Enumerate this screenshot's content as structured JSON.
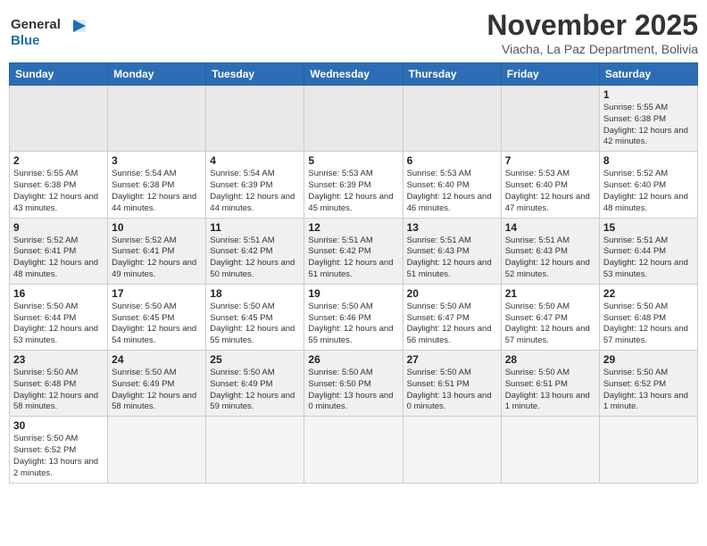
{
  "header": {
    "logo_general": "General",
    "logo_blue": "Blue",
    "month_title": "November 2025",
    "location": "Viacha, La Paz Department, Bolivia"
  },
  "days_of_week": [
    "Sunday",
    "Monday",
    "Tuesday",
    "Wednesday",
    "Thursday",
    "Friday",
    "Saturday"
  ],
  "weeks": [
    [
      {
        "day": "",
        "info": ""
      },
      {
        "day": "",
        "info": ""
      },
      {
        "day": "",
        "info": ""
      },
      {
        "day": "",
        "info": ""
      },
      {
        "day": "",
        "info": ""
      },
      {
        "day": "",
        "info": ""
      },
      {
        "day": "1",
        "info": "Sunrise: 5:55 AM\nSunset: 6:38 PM\nDaylight: 12 hours and 42 minutes."
      }
    ],
    [
      {
        "day": "2",
        "info": "Sunrise: 5:55 AM\nSunset: 6:38 PM\nDaylight: 12 hours and 43 minutes."
      },
      {
        "day": "3",
        "info": "Sunrise: 5:54 AM\nSunset: 6:38 PM\nDaylight: 12 hours and 44 minutes."
      },
      {
        "day": "4",
        "info": "Sunrise: 5:54 AM\nSunset: 6:39 PM\nDaylight: 12 hours and 44 minutes."
      },
      {
        "day": "5",
        "info": "Sunrise: 5:53 AM\nSunset: 6:39 PM\nDaylight: 12 hours and 45 minutes."
      },
      {
        "day": "6",
        "info": "Sunrise: 5:53 AM\nSunset: 6:40 PM\nDaylight: 12 hours and 46 minutes."
      },
      {
        "day": "7",
        "info": "Sunrise: 5:53 AM\nSunset: 6:40 PM\nDaylight: 12 hours and 47 minutes."
      },
      {
        "day": "8",
        "info": "Sunrise: 5:52 AM\nSunset: 6:40 PM\nDaylight: 12 hours and 48 minutes."
      }
    ],
    [
      {
        "day": "9",
        "info": "Sunrise: 5:52 AM\nSunset: 6:41 PM\nDaylight: 12 hours and 48 minutes."
      },
      {
        "day": "10",
        "info": "Sunrise: 5:52 AM\nSunset: 6:41 PM\nDaylight: 12 hours and 49 minutes."
      },
      {
        "day": "11",
        "info": "Sunrise: 5:51 AM\nSunset: 6:42 PM\nDaylight: 12 hours and 50 minutes."
      },
      {
        "day": "12",
        "info": "Sunrise: 5:51 AM\nSunset: 6:42 PM\nDaylight: 12 hours and 51 minutes."
      },
      {
        "day": "13",
        "info": "Sunrise: 5:51 AM\nSunset: 6:43 PM\nDaylight: 12 hours and 51 minutes."
      },
      {
        "day": "14",
        "info": "Sunrise: 5:51 AM\nSunset: 6:43 PM\nDaylight: 12 hours and 52 minutes."
      },
      {
        "day": "15",
        "info": "Sunrise: 5:51 AM\nSunset: 6:44 PM\nDaylight: 12 hours and 53 minutes."
      }
    ],
    [
      {
        "day": "16",
        "info": "Sunrise: 5:50 AM\nSunset: 6:44 PM\nDaylight: 12 hours and 53 minutes."
      },
      {
        "day": "17",
        "info": "Sunrise: 5:50 AM\nSunset: 6:45 PM\nDaylight: 12 hours and 54 minutes."
      },
      {
        "day": "18",
        "info": "Sunrise: 5:50 AM\nSunset: 6:45 PM\nDaylight: 12 hours and 55 minutes."
      },
      {
        "day": "19",
        "info": "Sunrise: 5:50 AM\nSunset: 6:46 PM\nDaylight: 12 hours and 55 minutes."
      },
      {
        "day": "20",
        "info": "Sunrise: 5:50 AM\nSunset: 6:47 PM\nDaylight: 12 hours and 56 minutes."
      },
      {
        "day": "21",
        "info": "Sunrise: 5:50 AM\nSunset: 6:47 PM\nDaylight: 12 hours and 57 minutes."
      },
      {
        "day": "22",
        "info": "Sunrise: 5:50 AM\nSunset: 6:48 PM\nDaylight: 12 hours and 57 minutes."
      }
    ],
    [
      {
        "day": "23",
        "info": "Sunrise: 5:50 AM\nSunset: 6:48 PM\nDaylight: 12 hours and 58 minutes."
      },
      {
        "day": "24",
        "info": "Sunrise: 5:50 AM\nSunset: 6:49 PM\nDaylight: 12 hours and 58 minutes."
      },
      {
        "day": "25",
        "info": "Sunrise: 5:50 AM\nSunset: 6:49 PM\nDaylight: 12 hours and 59 minutes."
      },
      {
        "day": "26",
        "info": "Sunrise: 5:50 AM\nSunset: 6:50 PM\nDaylight: 13 hours and 0 minutes."
      },
      {
        "day": "27",
        "info": "Sunrise: 5:50 AM\nSunset: 6:51 PM\nDaylight: 13 hours and 0 minutes."
      },
      {
        "day": "28",
        "info": "Sunrise: 5:50 AM\nSunset: 6:51 PM\nDaylight: 13 hours and 1 minute."
      },
      {
        "day": "29",
        "info": "Sunrise: 5:50 AM\nSunset: 6:52 PM\nDaylight: 13 hours and 1 minute."
      }
    ],
    [
      {
        "day": "30",
        "info": "Sunrise: 5:50 AM\nSunset: 6:52 PM\nDaylight: 13 hours and 2 minutes."
      },
      {
        "day": "",
        "info": ""
      },
      {
        "day": "",
        "info": ""
      },
      {
        "day": "",
        "info": ""
      },
      {
        "day": "",
        "info": ""
      },
      {
        "day": "",
        "info": ""
      },
      {
        "day": "",
        "info": ""
      }
    ]
  ]
}
